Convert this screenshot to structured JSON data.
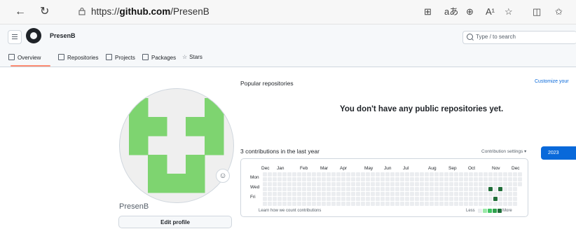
{
  "browser": {
    "url_prefix": "https://",
    "url_domain": "github.com",
    "url_path": "/PresenB",
    "tb_translate": "aあ",
    "tb_read": "A¹"
  },
  "header": {
    "username": "PresenB",
    "search_placeholder": "Type / to search"
  },
  "nav": {
    "overview": "Overview",
    "repositories": "Repositories",
    "projects": "Projects",
    "packages": "Packages",
    "stars": "Stars"
  },
  "profile": {
    "name": "PresenB",
    "edit_label": "Edit profile",
    "status_icon": "smiley-icon"
  },
  "main": {
    "popular_title": "Popular repositories",
    "customize_label": "Customize your",
    "empty_message": "You don't have any public repositories yet.",
    "contrib_title": "3 contributions in the last year",
    "settings_label": "Contribution settings ▾",
    "year_label": "2023",
    "learn_link": "Learn how we count contributions",
    "legend_less": "Less",
    "legend_more": "More"
  },
  "calendar": {
    "months": [
      "Dec",
      "Jan",
      "Feb",
      "Mar",
      "Apr",
      "May",
      "Jun",
      "Jul",
      "Aug",
      "Sep",
      "Oct",
      "Nov",
      "Dec"
    ],
    "weekdays": [
      "Mon",
      "Wed",
      "Fri"
    ],
    "weeks": 53,
    "contributions": [
      {
        "week": 46,
        "day": 3
      },
      {
        "week": 47,
        "day": 5
      },
      {
        "week": 48,
        "day": 3
      }
    ],
    "colors": {
      "empty": "#ebedf0",
      "level1": "#9be9a8",
      "level2": "#40c463",
      "level3": "#30a14e",
      "level4": "#216e39"
    }
  },
  "avatar_color": "#7ed470"
}
